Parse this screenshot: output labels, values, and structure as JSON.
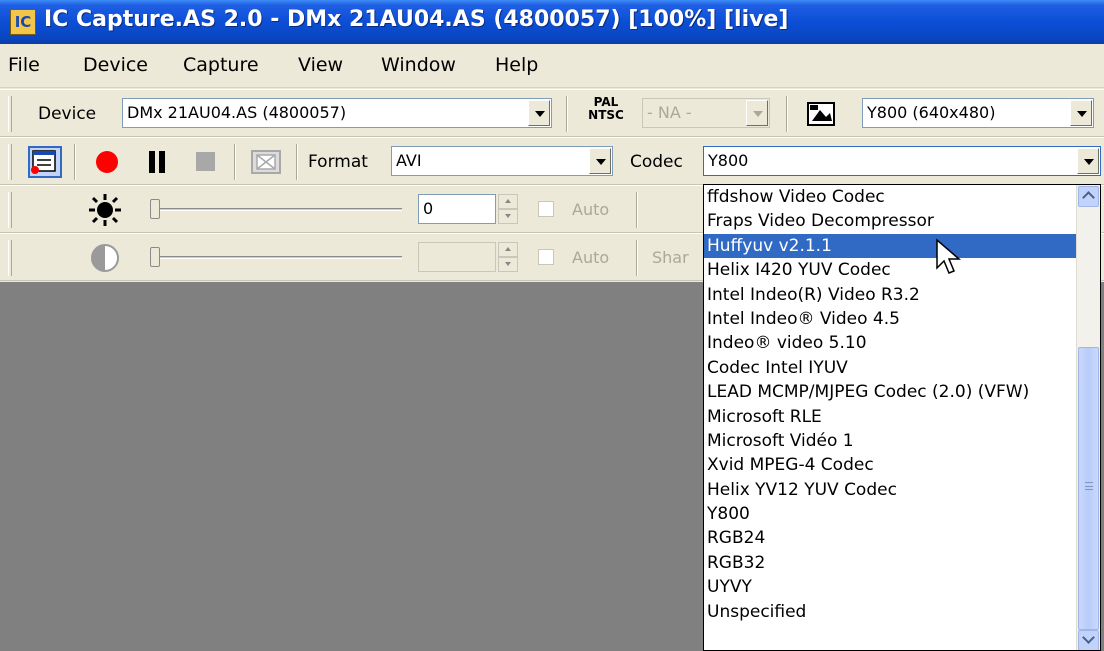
{
  "window": {
    "title": "IC Capture.AS 2.0 - DMx 21AU04.AS (4800057) [100%]  [live]",
    "app_icon": "IC"
  },
  "menu": [
    "File",
    "Device",
    "Capture",
    "View",
    "Window",
    "Help"
  ],
  "toolbar1": {
    "device_label": "Device",
    "device_value": "DMx 21AU04.AS (4800057)",
    "pal_label": "PAL",
    "ntsc_label": "NTSC",
    "videonorm_value": "- NA -",
    "format_value": "Y800 (640x480)"
  },
  "toolbar2": {
    "format_label": "Format",
    "format_value": "AVI",
    "codec_label": "Codec",
    "codec_value": "Y800"
  },
  "toolbar3": {
    "brightness_value": "0",
    "auto_label": "Auto"
  },
  "toolbar4": {
    "contrast_value": "",
    "auto_label": "Auto",
    "sharpness_label": "Shar"
  },
  "codec_dropdown": {
    "selected_index": 2,
    "options": [
      "ffdshow Video Codec",
      "Fraps Video Decompressor",
      "Huffyuv v2.1.1",
      "Helix I420 YUV Codec",
      "Intel Indeo(R) Video R3.2",
      "Intel Indeo® Video 4.5",
      "Indeo® video 5.10",
      "Codec Intel IYUV",
      "LEAD MCMP/MJPEG Codec (2.0) (VFW)",
      "Microsoft RLE",
      "Microsoft Vidéo 1",
      "Xvid MPEG-4 Codec",
      "Helix YV12 YUV Codec",
      "Y800",
      "RGB24",
      "RGB32",
      "UYVY",
      "Unspecified"
    ]
  },
  "colors": {
    "title_blue": "#0b4fd6",
    "selection": "#316ac5",
    "record_red": "#ff0000",
    "video_gray": "#808080"
  }
}
